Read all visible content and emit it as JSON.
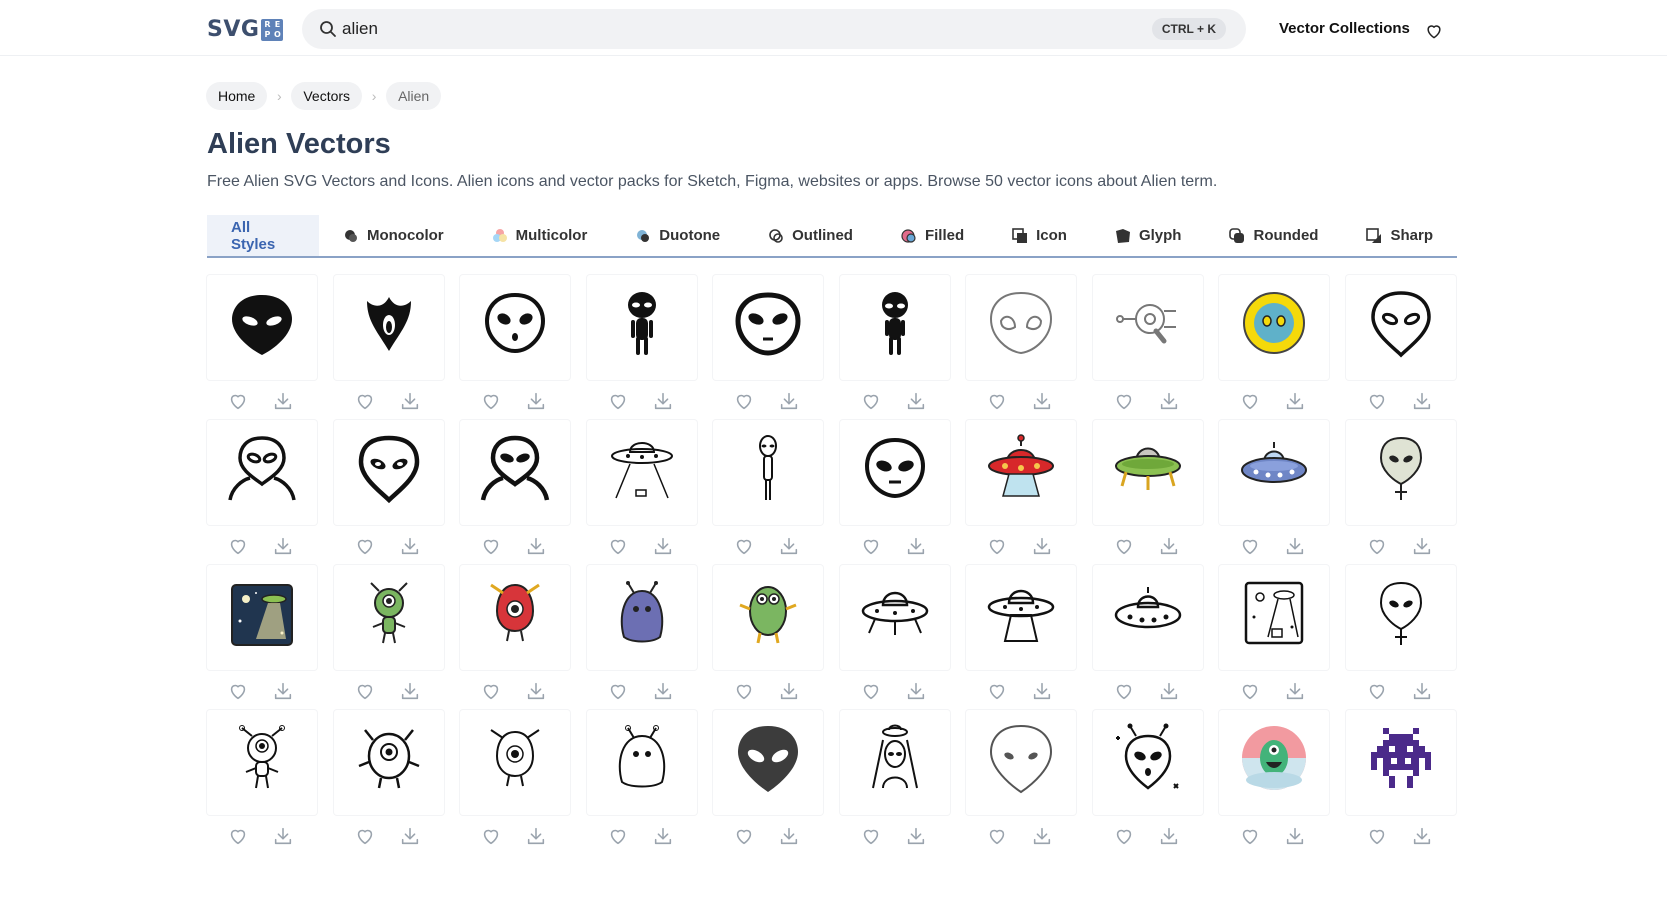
{
  "logo": {
    "text": "SVG",
    "box": [
      "R",
      "E",
      "P",
      "O"
    ]
  },
  "search": {
    "value": "alien",
    "placeholder": "Search",
    "shortcut": "CTRL + K"
  },
  "nav": {
    "collections": "Vector Collections"
  },
  "breadcrumb": {
    "items": [
      "Home",
      "Vectors",
      "Alien"
    ]
  },
  "page": {
    "title": "Alien Vectors",
    "description": "Free Alien SVG Vectors and Icons. Alien icons and vector packs for Sketch, Figma, websites or apps. Browse 50 vector icons about Alien term."
  },
  "tabs": [
    {
      "label": "All Styles",
      "icon": "",
      "active": true
    },
    {
      "label": "Monocolor",
      "icon": "monocolor-icon"
    },
    {
      "label": "Multicolor",
      "icon": "multicolor-icon"
    },
    {
      "label": "Duotone",
      "icon": "duotone-icon"
    },
    {
      "label": "Outlined",
      "icon": "outlined-icon"
    },
    {
      "label": "Filled",
      "icon": "filled-icon"
    },
    {
      "label": "Icon",
      "icon": "icon-style-icon"
    },
    {
      "label": "Glyph",
      "icon": "glyph-icon"
    },
    {
      "label": "Rounded",
      "icon": "rounded-icon"
    },
    {
      "label": "Sharp",
      "icon": "sharp-icon"
    }
  ],
  "colors": {
    "accent": "#3b65b0",
    "tab_underline": "#8aa2c6",
    "icon_action": "#9aa3ad"
  },
  "icons": [
    "alien-head-solid",
    "alien-tribal",
    "alien-head-round",
    "alien-figure",
    "alien-head-outline-bold",
    "alien-figure-2",
    "alien-head-thin-outline",
    "alien-raygun",
    "alien-yellow-circle",
    "alien-head-line",
    "alien-bust-line",
    "alien-head-line-2",
    "alien-bust-bold",
    "ufo-beam",
    "alien-figure-thin",
    "alien-face-round",
    "ufo-red",
    "ufo-green",
    "ufo-blue",
    "alien-balloon-color",
    "alien-night-scene",
    "alien-cyclops-green",
    "alien-cyclops-red",
    "alien-blob-purple",
    "alien-monster-green",
    "ufo-line",
    "ufo-beam-line",
    "ufo-flat-line",
    "alien-abduction-line",
    "alien-balloon-line",
    "alien-cyclops-line",
    "alien-monster-line",
    "alien-cyclops-line-2",
    "alien-blob-line",
    "alien-head-gray",
    "alien-ufo-bust",
    "alien-head-gray-outline",
    "alien-sparkle",
    "alien-bubble-color",
    "space-invader"
  ]
}
